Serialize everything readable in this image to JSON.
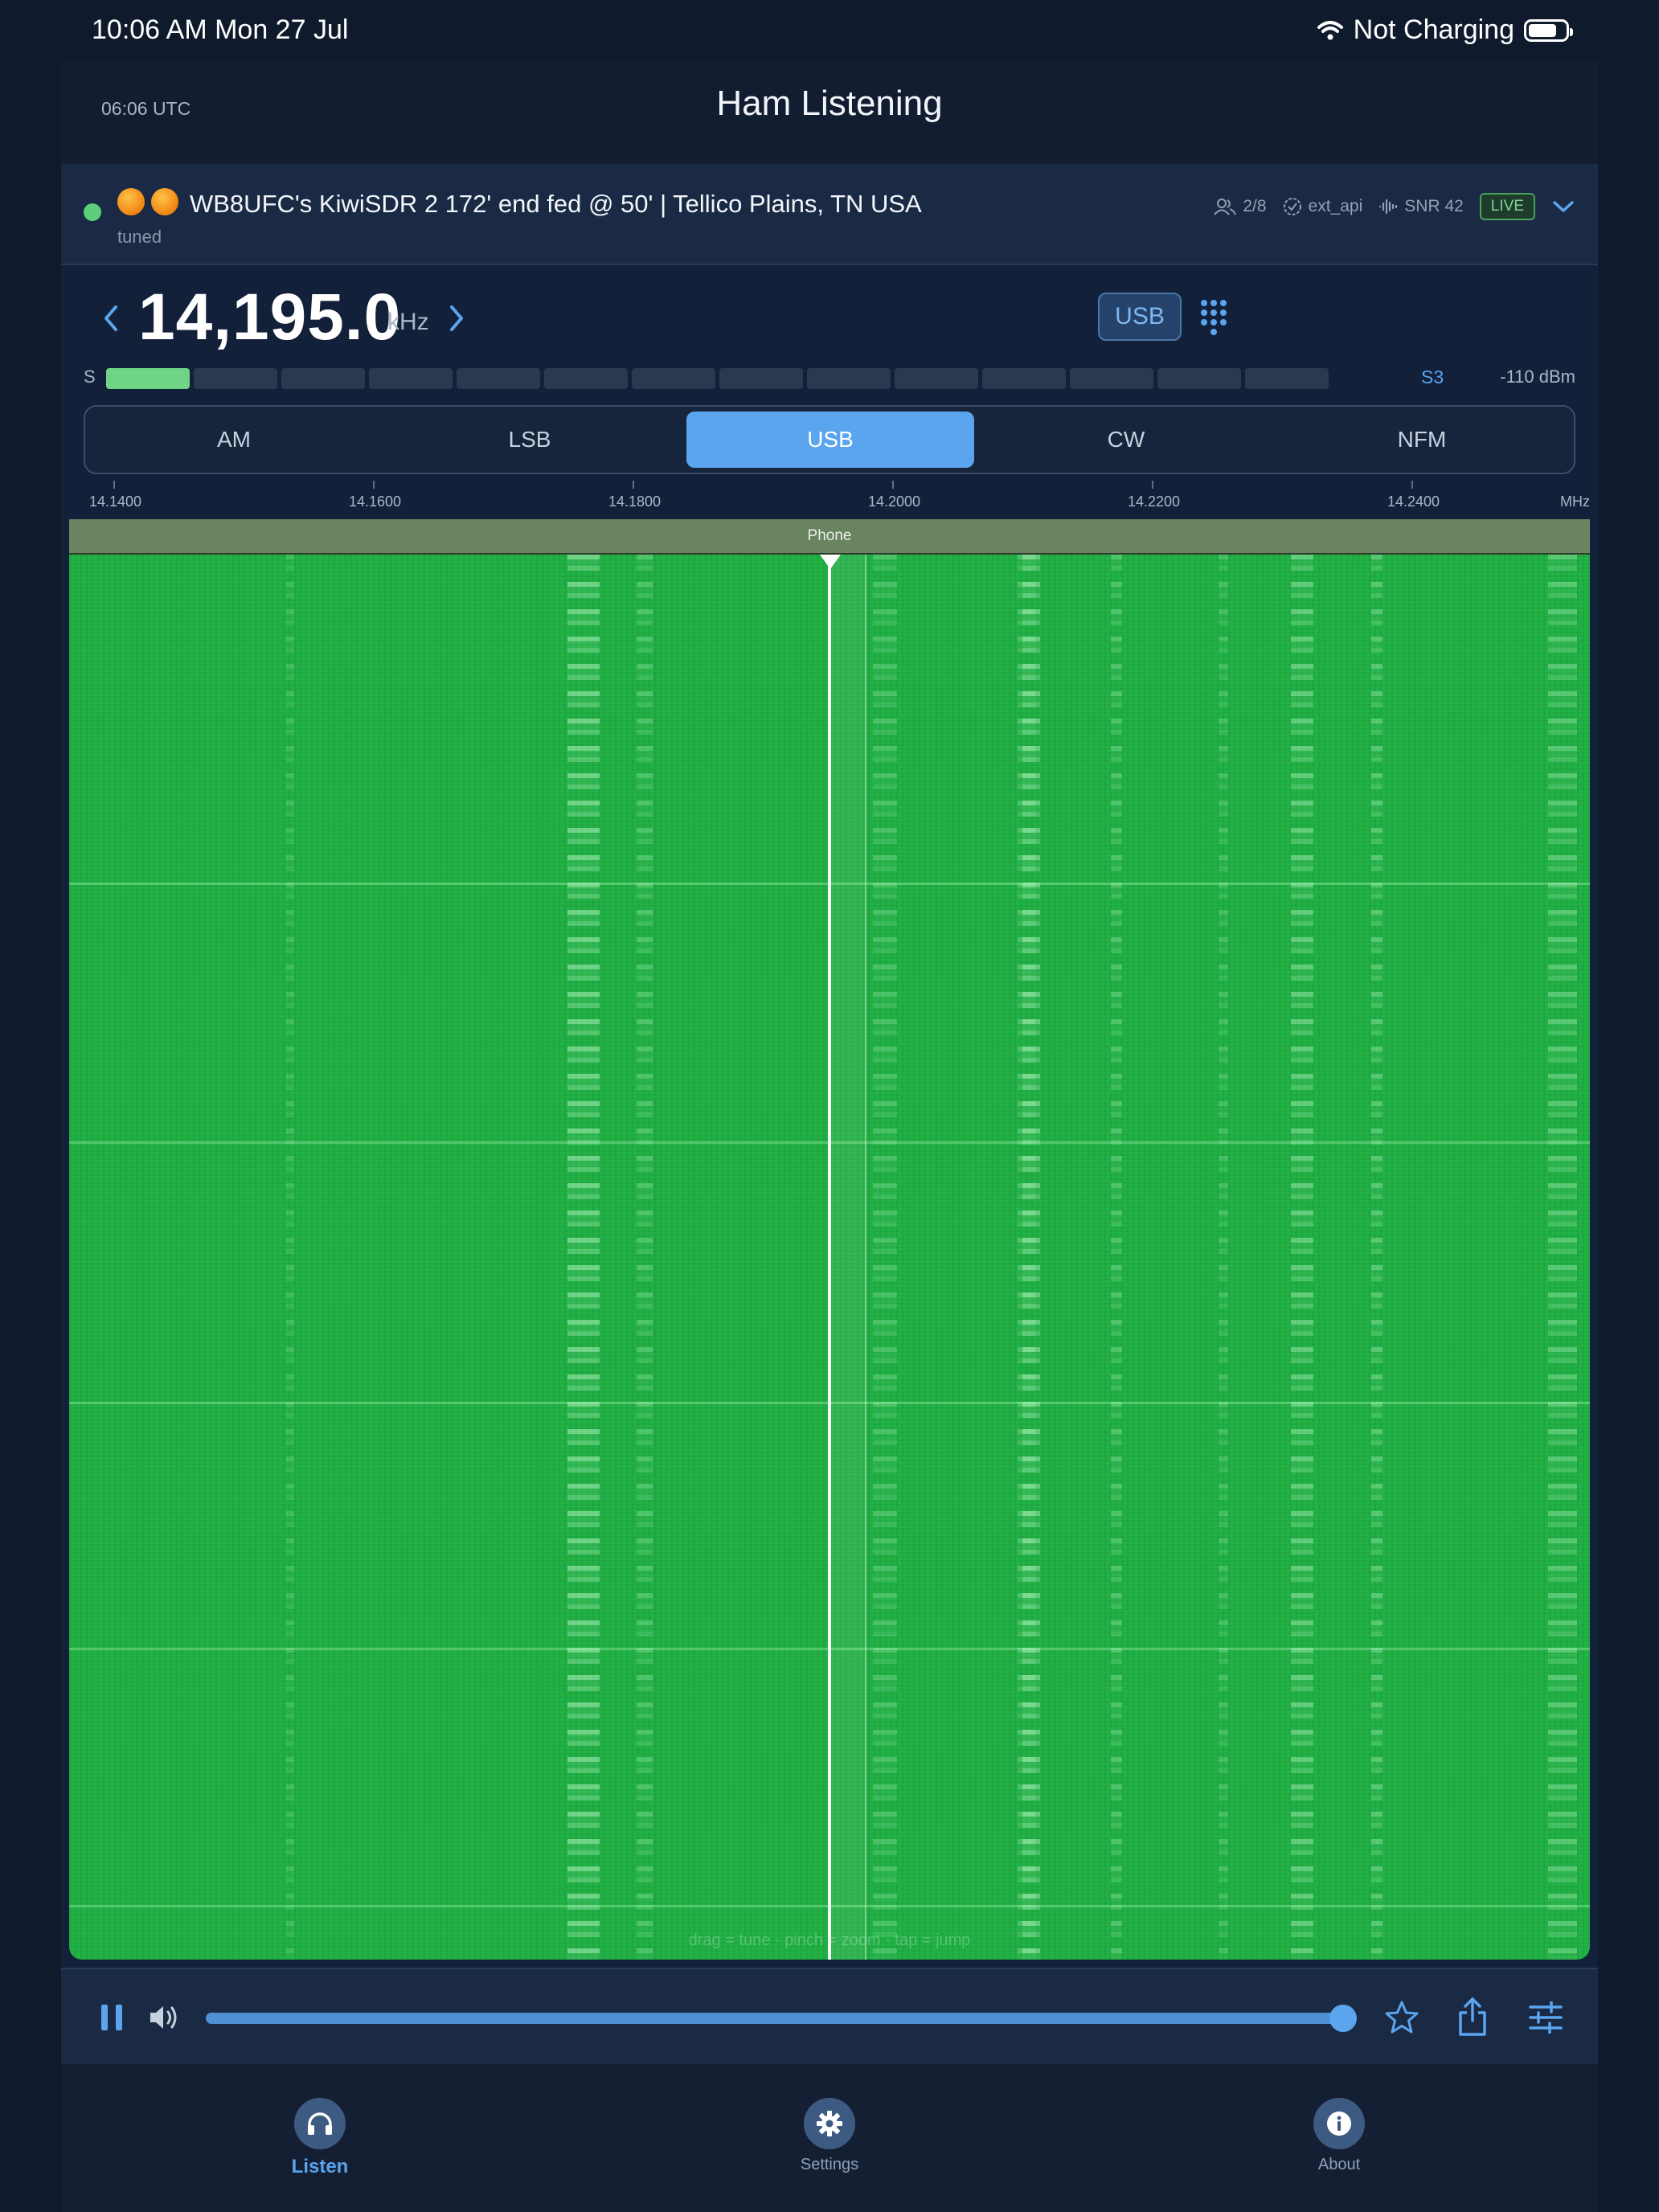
{
  "status_bar": {
    "time": "10:06 AM   Mon 27 Jul",
    "charging": "Not Charging"
  },
  "header": {
    "utc_time": "06:06 UTC",
    "title": "Ham Listening"
  },
  "station": {
    "name": "WB8UFC's KiwiSDR 2 172' end fed @ 50' | Tellico Plains, TN USA",
    "state": "tuned",
    "users": "2/8",
    "api": "ext_api",
    "snr": "SNR 42",
    "live": "LIVE"
  },
  "tuner": {
    "frequency": "14,195.0",
    "unit": "kHz",
    "mode": "USB"
  },
  "smeter": {
    "label": "S",
    "reading": "S3",
    "dbm": "-110 dBm",
    "level_fraction": 0.07,
    "segment_count": 14,
    "segments_lit": 1
  },
  "modes": [
    "AM",
    "LSB",
    "USB",
    "CW",
    "NFM"
  ],
  "active_mode": "USB",
  "scale": {
    "ticks": [
      "14.1400",
      "14.1600",
      "14.1800",
      "14.2000",
      "14.2200",
      "14.2400"
    ],
    "unit": "MHz"
  },
  "band": {
    "label": "Phone"
  },
  "waterfall": {
    "hint": "drag = tune · pinch = zoom · tap = jump"
  },
  "player": {
    "volume_fraction": 0.99
  },
  "tabs": [
    {
      "label": "Listen",
      "icon": "headphones-icon"
    },
    {
      "label": "Settings",
      "icon": "gear-icon"
    },
    {
      "label": "About",
      "icon": "info-icon"
    }
  ],
  "colors": {
    "accent": "#5aa5ee",
    "waterfall": "#22b246",
    "live": "#7ed592"
  }
}
